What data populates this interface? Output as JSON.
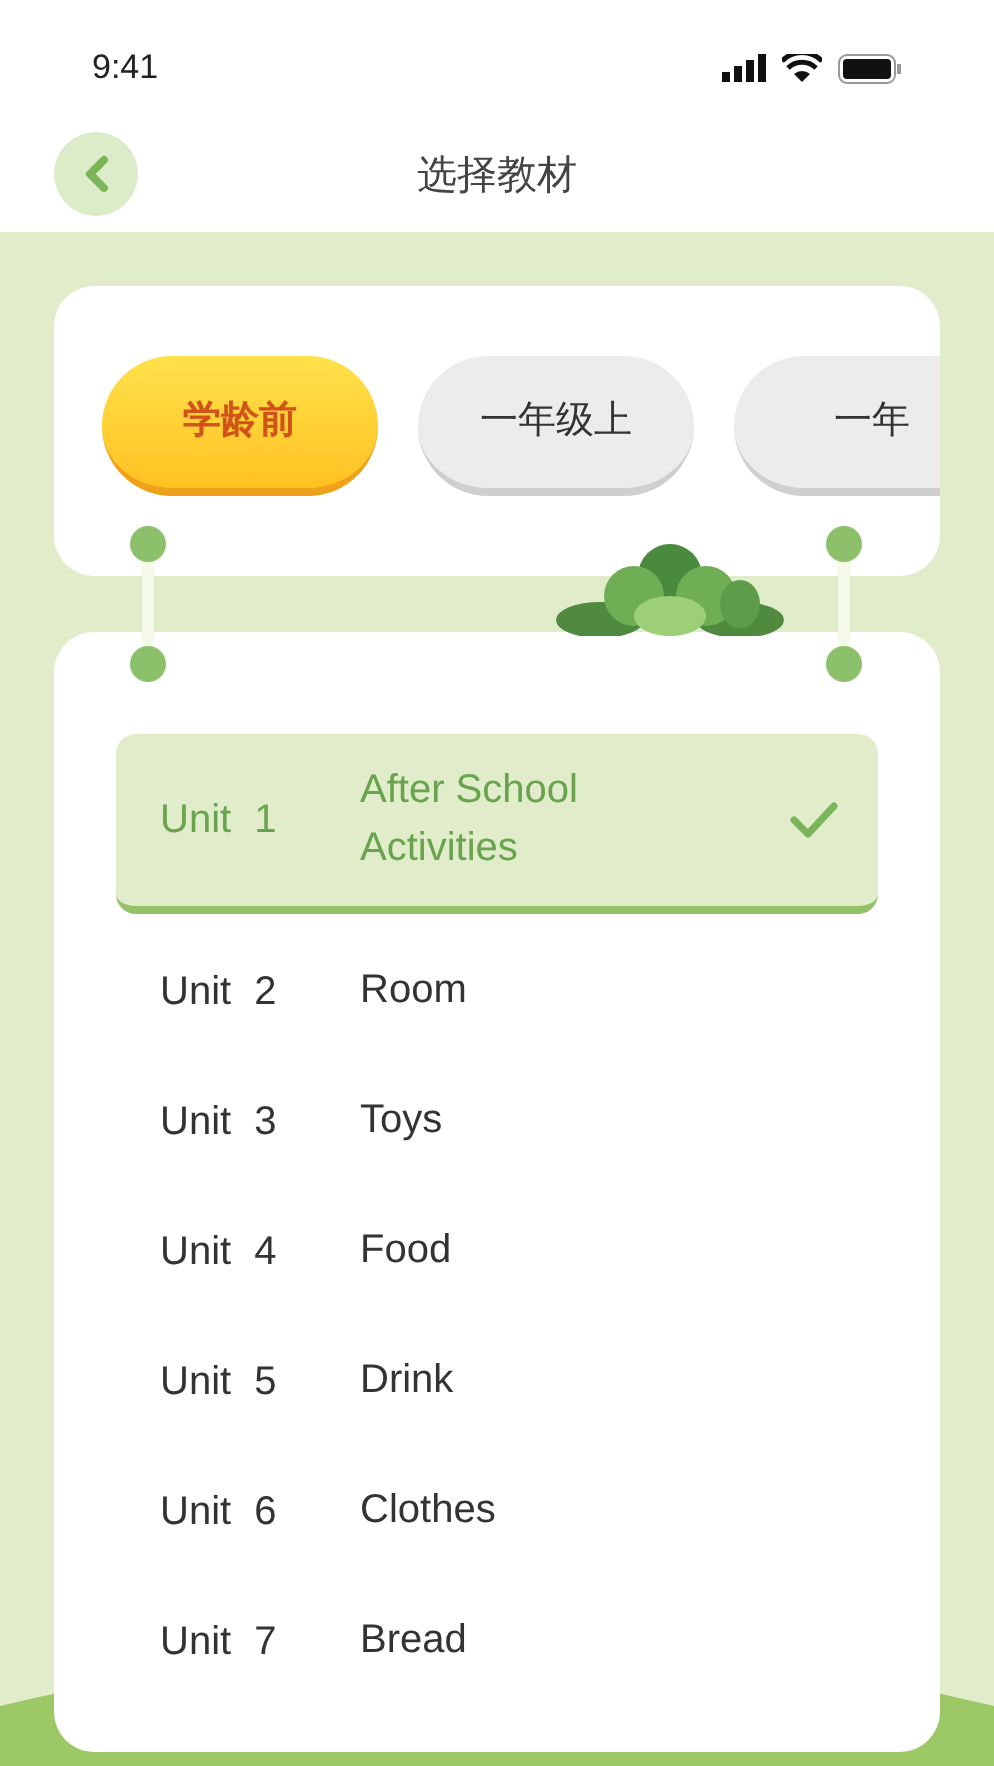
{
  "status_bar": {
    "time": "9:41"
  },
  "header": {
    "title": "选择教材"
  },
  "grades": [
    {
      "label": "学龄前",
      "selected": true
    },
    {
      "label": "一年级上",
      "selected": false
    },
    {
      "label": "一年",
      "selected": false
    }
  ],
  "units": [
    {
      "unit": "Unit 1",
      "title": "After School Activities",
      "selected": true
    },
    {
      "unit": "Unit 2",
      "title": "Room",
      "selected": false
    },
    {
      "unit": "Unit 3",
      "title": "Toys",
      "selected": false
    },
    {
      "unit": "Unit 4",
      "title": "Food",
      "selected": false
    },
    {
      "unit": "Unit 5",
      "title": "Drink",
      "selected": false
    },
    {
      "unit": "Unit 6",
      "title": "Clothes",
      "selected": false
    },
    {
      "unit": "Unit 7",
      "title": "Bread",
      "selected": false
    }
  ]
}
